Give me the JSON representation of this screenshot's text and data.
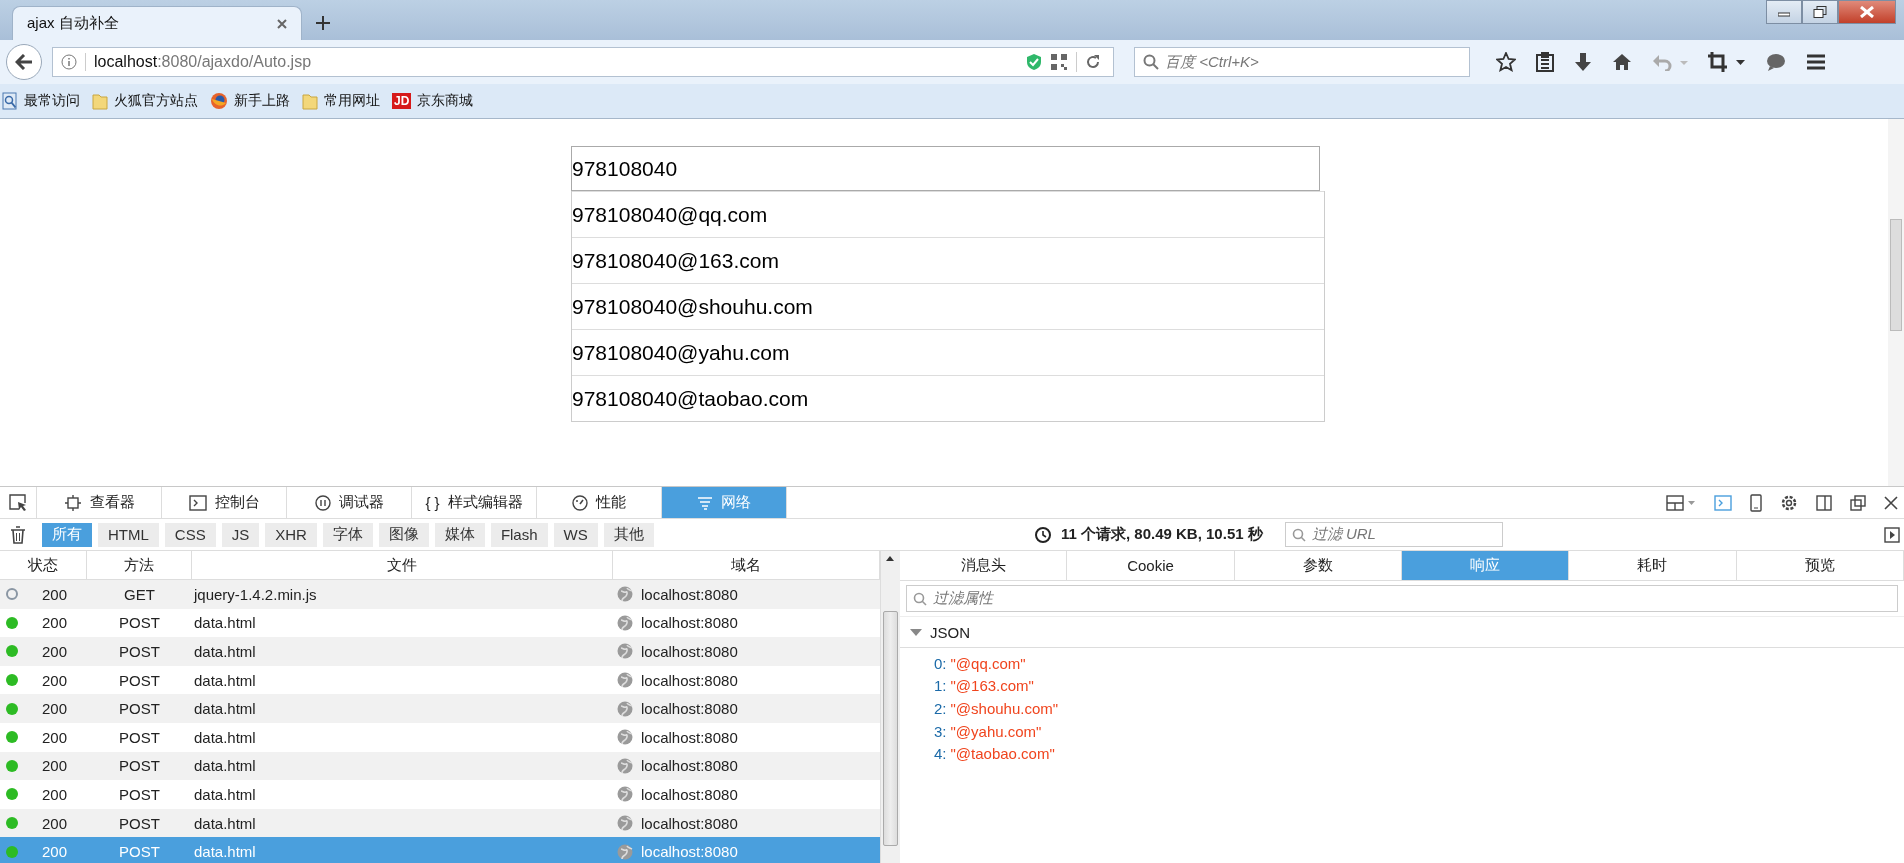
{
  "window": {
    "tab_title": "ajax 自动补全"
  },
  "nav": {
    "url_host": "localhost",
    "url_rest": ":8080/ajaxdo/Auto.jsp",
    "search_placeholder": "百度 <Ctrl+K>"
  },
  "bookmarks": [
    {
      "kind": "page",
      "label": "最常访问"
    },
    {
      "kind": "folder",
      "label": "火狐官方站点"
    },
    {
      "kind": "globe",
      "label": "新手上路"
    },
    {
      "kind": "folder",
      "label": "常用网址"
    },
    {
      "kind": "logo",
      "badge": "JD",
      "label": "京东商城"
    }
  ],
  "page": {
    "input_value": "978108040",
    "suggestions": [
      "978108040@qq.com",
      "978108040@163.com",
      "978108040@shouhu.com",
      "978108040@yahu.com",
      "978108040@taobao.com"
    ]
  },
  "devtools": {
    "tabs": [
      {
        "kind": "inspector",
        "label": "查看器",
        "selected": false
      },
      {
        "kind": "console",
        "label": "控制台",
        "selected": false
      },
      {
        "kind": "debugger",
        "label": "调试器",
        "selected": false
      },
      {
        "kind": "style",
        "glyph": "{ }",
        "label": "样式编辑器",
        "selected": false
      },
      {
        "kind": "performance",
        "label": "性能",
        "selected": false
      },
      {
        "kind": "network",
        "label": "网络",
        "selected": true
      }
    ],
    "filters": [
      {
        "label": "所有",
        "selected": true
      },
      {
        "label": "HTML",
        "selected": false
      },
      {
        "label": "CSS",
        "selected": false
      },
      {
        "label": "JS",
        "selected": false
      },
      {
        "label": "XHR",
        "selected": false
      },
      {
        "label": "字体",
        "selected": false
      },
      {
        "label": "图像",
        "selected": false
      },
      {
        "label": "媒体",
        "selected": false
      },
      {
        "label": "Flash",
        "selected": false
      },
      {
        "label": "WS",
        "selected": false
      },
      {
        "label": "其他",
        "selected": false
      }
    ],
    "summary": "11 个请求, 80.49 KB, 10.51 秒",
    "filter_url_placeholder": "过滤 URL",
    "table": {
      "columns": [
        "状态",
        "方法",
        "文件",
        "域名"
      ],
      "rows": [
        {
          "kind": "ring",
          "color": "#8a96a3",
          "status": "200",
          "method": "GET",
          "file": "jquery-1.4.2.min.js",
          "domain": "localhost:8080",
          "selected": false
        },
        {
          "kind": "dot",
          "color": "#2dbb24",
          "status": "200",
          "method": "POST",
          "file": "data.html",
          "domain": "localhost:8080",
          "selected": false
        },
        {
          "kind": "dot",
          "color": "#2dbb24",
          "status": "200",
          "method": "POST",
          "file": "data.html",
          "domain": "localhost:8080",
          "selected": false
        },
        {
          "kind": "dot",
          "color": "#2dbb24",
          "status": "200",
          "method": "POST",
          "file": "data.html",
          "domain": "localhost:8080",
          "selected": false
        },
        {
          "kind": "dot",
          "color": "#2dbb24",
          "status": "200",
          "method": "POST",
          "file": "data.html",
          "domain": "localhost:8080",
          "selected": false
        },
        {
          "kind": "dot",
          "color": "#2dbb24",
          "status": "200",
          "method": "POST",
          "file": "data.html",
          "domain": "localhost:8080",
          "selected": false
        },
        {
          "kind": "dot",
          "color": "#2dbb24",
          "status": "200",
          "method": "POST",
          "file": "data.html",
          "domain": "localhost:8080",
          "selected": false
        },
        {
          "kind": "dot",
          "color": "#2dbb24",
          "status": "200",
          "method": "POST",
          "file": "data.html",
          "domain": "localhost:8080",
          "selected": false
        },
        {
          "kind": "dot",
          "color": "#2dbb24",
          "status": "200",
          "method": "POST",
          "file": "data.html",
          "domain": "localhost:8080",
          "selected": false
        },
        {
          "kind": "dot",
          "color": "#2dbb24",
          "status": "200",
          "method": "POST",
          "file": "data.html",
          "domain": "localhost:8080",
          "selected": true
        }
      ]
    },
    "detail": {
      "tabs": [
        {
          "label": "消息头",
          "selected": false
        },
        {
          "label": "Cookie",
          "selected": false
        },
        {
          "label": "参数",
          "selected": false
        },
        {
          "label": "响应",
          "selected": true
        },
        {
          "label": "耗时",
          "selected": false
        },
        {
          "label": "预览",
          "selected": false
        }
      ],
      "filter_placeholder": "过滤属性",
      "section": {
        "title": "JSON",
        "expanded": true,
        "items": [
          {
            "key": "0:",
            "value": "\"@qq.com\""
          },
          {
            "key": "1:",
            "value": "\"@163.com\""
          },
          {
            "key": "2:",
            "value": "\"@shouhu.com\""
          },
          {
            "key": "3:",
            "value": "\"@yahu.com\""
          },
          {
            "key": "4:",
            "value": "\"@taobao.com\""
          }
        ]
      }
    }
  }
}
